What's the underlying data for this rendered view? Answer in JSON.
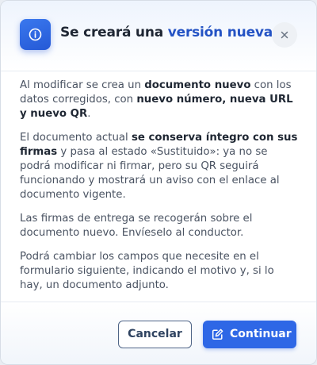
{
  "dialog": {
    "title_part1": "Se creará una ",
    "title_part2": "versión nueva",
    "header_icon": "info-icon",
    "close_icon": "close-icon",
    "colors": {
      "accent": "#2453c4",
      "primary_button": "#2e67e6",
      "secondary_border": "#4f6587"
    }
  },
  "body": {
    "p1": {
      "t1": "Al modificar se crea un ",
      "b1": "documento nuevo",
      "t2": " con los datos corregidos, con ",
      "b2": "nuevo número, nueva URL y nuevo QR",
      "t3": "."
    },
    "p2": {
      "t1": "El documento actual ",
      "b1": "se conserva íntegro con sus firmas",
      "t2": " y pasa al estado «Sustituido»: ya no se podrá modificar ni firmar, pero su QR seguirá funcionando y mostrará un aviso con el enlace al documento vigente."
    },
    "p3": "Las firmas de entrega se recogerán sobre el documento nuevo. Envíeselo al conductor.",
    "p4": "Podrá cambiar los campos que necesite en el formulario siguiente, indicando el motivo y, si lo hay, un documento adjunto."
  },
  "footer": {
    "cancel_label": "Cancelar",
    "continue_label": "Continuar",
    "continue_icon": "edit-icon"
  }
}
